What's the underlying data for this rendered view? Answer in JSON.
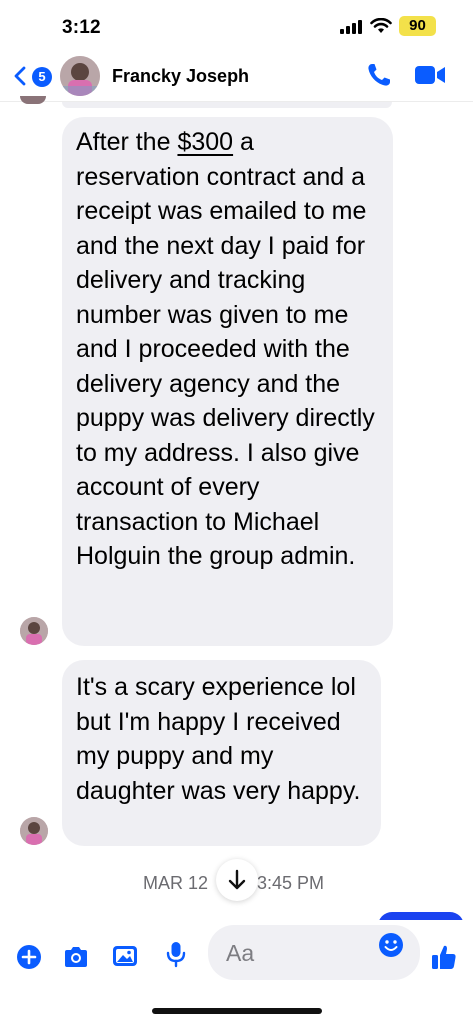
{
  "status_bar": {
    "time": "3:12",
    "battery": "90",
    "icons": [
      "signal-icon",
      "wifi-icon",
      "battery-icon"
    ]
  },
  "header": {
    "back_count": "5",
    "contact_name": "Francky Joseph",
    "icons": [
      "back-chevron-icon",
      "phone-icon",
      "video-camera-icon"
    ]
  },
  "messages": [
    {
      "sender": "Francky Joseph",
      "text_before_link": "After the ",
      "link_text": "$300",
      "text_after_link": " a reservation contract and a receipt was emailed to me and the next day I paid for delivery and tracking number was given to me and I proceeded with the delivery agency and the puppy was delivery directly to my address. I also give account of every transaction to Michael Holguin the group admin."
    },
    {
      "sender": "Francky Joseph",
      "text": "It's a scary experience lol but I'm happy I received my puppy and my daughter was very happy."
    }
  ],
  "timestamp": {
    "left": "MAR 12",
    "right": "3:45 PM"
  },
  "composer": {
    "placeholder": "Aa",
    "icons": [
      "plus-icon",
      "camera-icon",
      "gallery-icon",
      "microphone-icon",
      "emoji-icon",
      "thumbs-up-icon"
    ]
  },
  "colors": {
    "accent": "#0a5cff",
    "bubble_received": "#efeff3",
    "bubble_sent": "#1a43f0",
    "battery": "#f3e14a"
  }
}
